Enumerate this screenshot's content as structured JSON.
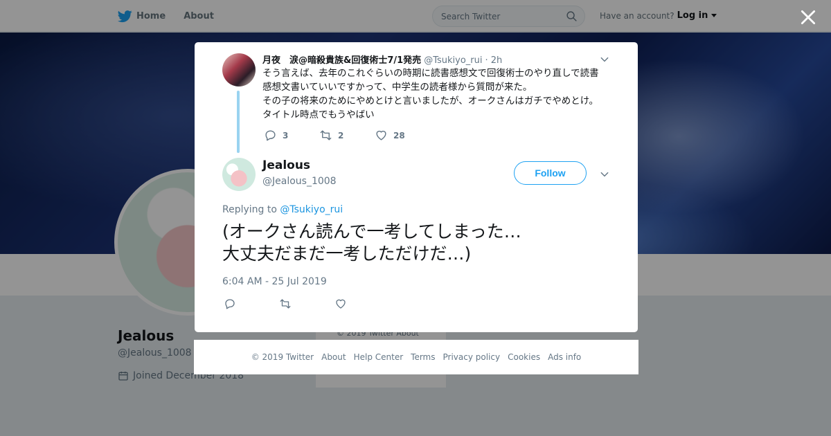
{
  "topbar": {
    "home_label": "Home",
    "about_label": "About",
    "search_placeholder": "Search Twitter",
    "have_account": "Have an account?",
    "login_label": "Log in"
  },
  "profile": {
    "name": "Jealous",
    "handle": "@Jealous_1008",
    "joined": "Joined December 2018",
    "mini_footer": "© 2019 Twitter   About"
  },
  "parent_tweet": {
    "author_name": "月夜　涙@暗殺貴族&回復術士7/1発売",
    "author_handle": "@Tsukiyo_rui",
    "time": "· 2h",
    "text": "そう言えば、去年のこれぐらいの時期に読書感想文で回復術士のやり直しで読書感想文書いていいですかって、中学生の読者様から質問が来た。\nその子の将来のためにやめとけと言いましたが、オークさんはガチでやめとけ。タイトル時点でもうやばい",
    "reply_count": "3",
    "retweet_count": "2",
    "like_count": "28"
  },
  "main_tweet": {
    "author_name": "Jealous",
    "author_handle": "@Jealous_1008",
    "follow_label": "Follow",
    "replying_prefix": "Replying to",
    "replying_to": "@Tsukiyo_rui",
    "text": "(オークさん読んで一考してしまった…\n大丈夫だまだ一考しただけだ…)",
    "timestamp": "6:04 AM - 25 Jul 2019"
  },
  "footer": {
    "copyright": "© 2019 Twitter",
    "about": "About",
    "help": "Help Center",
    "terms": "Terms",
    "privacy": "Privacy policy",
    "cookies": "Cookies",
    "ads": "Ads info"
  },
  "colors": {
    "accent": "#1da1f2",
    "thread_line": "#9ad3f0",
    "muted_text": "#657786"
  },
  "icons": [
    "twitter-bird-icon",
    "home-icon",
    "search-icon",
    "close-icon",
    "chevron-down-icon",
    "reply-icon",
    "retweet-icon",
    "heart-icon",
    "calendar-icon"
  ]
}
